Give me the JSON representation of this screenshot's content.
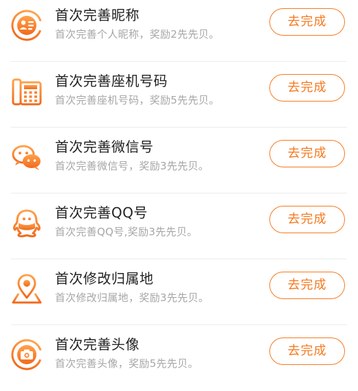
{
  "theme": {
    "accent": "#f57a1f",
    "title_color": "#222222",
    "desc_color": "#a6a6a6",
    "divider": "#ececec"
  },
  "tasks": [
    {
      "icon": "nickname-card-icon",
      "title": "首次完善昵称",
      "desc": "首次完善个人昵称，奖励2先先贝。",
      "action": "去完成"
    },
    {
      "icon": "landline-phone-icon",
      "title": "首次完善座机号码",
      "desc": "首次完善座机号码，奖励5先先贝。",
      "action": "去完成"
    },
    {
      "icon": "wechat-icon",
      "title": "首次完善微信号",
      "desc": "首次完善微信号，奖励3先先贝。",
      "action": "去完成"
    },
    {
      "icon": "qq-icon",
      "title": "首次完善QQ号",
      "desc": "首次完善QQ号,奖励3先先贝。",
      "action": "去完成"
    },
    {
      "icon": "location-pin-icon",
      "title": "首次修改归属地",
      "desc": "首次修改归属地，奖励3先先贝。",
      "action": "去完成"
    },
    {
      "icon": "camera-avatar-icon",
      "title": "首次完善头像",
      "desc": "首次完善头像，奖励5先先贝。",
      "action": "去完成"
    }
  ]
}
